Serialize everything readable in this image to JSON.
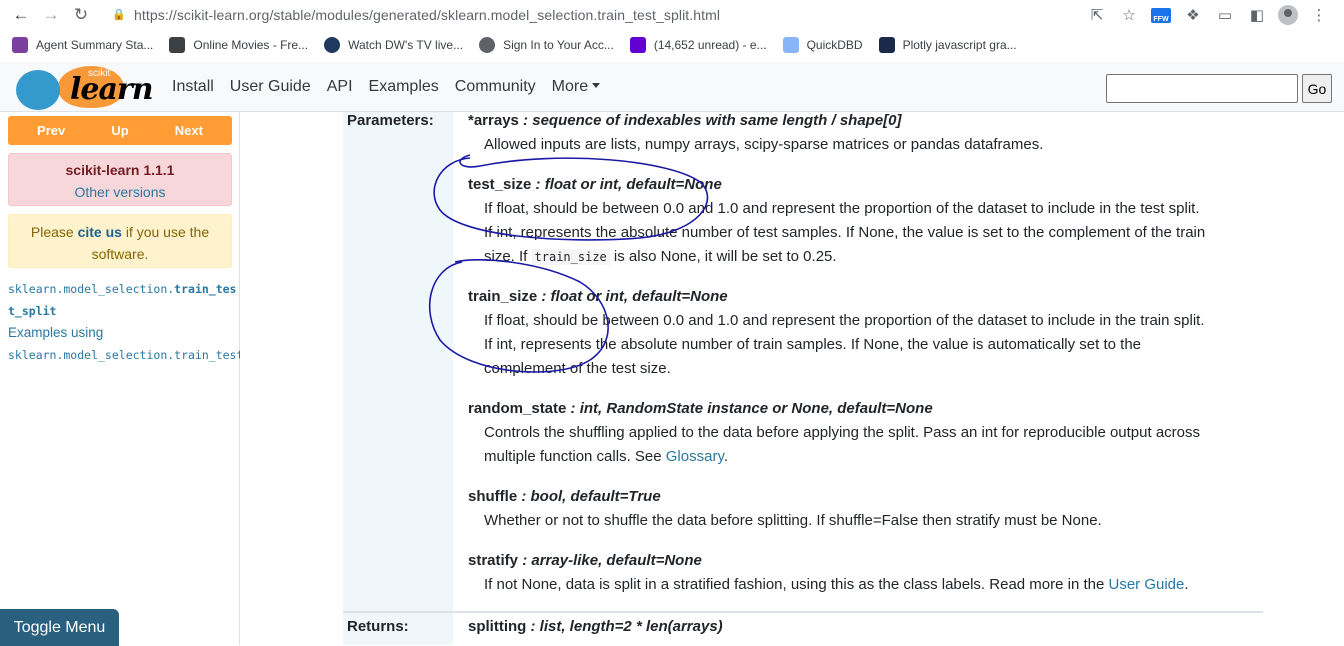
{
  "browser": {
    "url": "https://scikit-learn.org/stable/modules/generated/sklearn.model_selection.train_test_split.html",
    "bookmarks": [
      {
        "label": "Agent Summary Sta...",
        "color": "#7b3fa0"
      },
      {
        "label": "Online Movies - Fre...",
        "color": "#3c4043"
      },
      {
        "label": "Watch DW's TV live...",
        "color": "#1f3a5f"
      },
      {
        "label": "Sign In to Your Acc...",
        "color": "#5f6368"
      },
      {
        "label": "(14,652 unread) - e...",
        "color": "#6001d2"
      },
      {
        "label": "QuickDBD",
        "color": "#8ab4f8"
      },
      {
        "label": "Plotly javascript gra...",
        "color": "#1c2a4a"
      }
    ],
    "ext_label": "FFW"
  },
  "navbar": {
    "logo_small": "scikit",
    "logo_big": "learn",
    "links": [
      "Install",
      "User Guide",
      "API",
      "Examples",
      "Community",
      "More"
    ],
    "search_placeholder": "",
    "go_label": "Go"
  },
  "sidebar": {
    "prev": "Prev",
    "up": "Up",
    "next": "Next",
    "version_title": "scikit-learn 1.1.1",
    "other_versions": "Other versions",
    "cite_pre": "Please ",
    "cite_link": "cite us",
    "cite_post": " if you use the software.",
    "toc_module": "sklearn.model_selection.",
    "toc_func1": "train_tes",
    "toc_func2": "t_split",
    "toc_examples": "Examples using",
    "toc_examples_code": "sklearn.model_selection.train_test_split",
    "toggle_menu": "Toggle Menu"
  },
  "content": {
    "parameters_label": "Parameters:",
    "returns_label": "Returns:",
    "params": [
      {
        "name": "*arrays",
        "type": "sequence of indexables with same length / shape[0]",
        "desc": [
          "Allowed inputs are lists, numpy arrays, scipy-sparse matrices or pandas dataframes."
        ]
      },
      {
        "name": "test_size",
        "type": "float or int, default=None",
        "desc": [
          "If float, should be between 0.0 and 1.0 and represent the proportion of the dataset to include in the test split.",
          "If int, represents the absolute number of test samples. If None, the value is set to the complement of the train"
        ],
        "desc3_pre": "size. If ",
        "desc3_code": "train_size",
        "desc3_post": " is also None, it will be set to 0.25."
      },
      {
        "name": "train_size",
        "type": "float or int, default=None",
        "desc": [
          "If float, should be between 0.0 and 1.0 and represent the proportion of the dataset to include in the train split.",
          "If int, represents the absolute number of train samples. If None, the value is automatically set to the",
          "complement of the test size."
        ]
      },
      {
        "name": "random_state",
        "type": "int, RandomState instance or None, default=None",
        "desc": [
          "Controls the shuffling applied to the data before applying the split. Pass an int for reproducible output across"
        ],
        "desc2_pre": "multiple function calls. See ",
        "desc2_link": "Glossary",
        "desc2_post": "."
      },
      {
        "name": "shuffle",
        "type": "bool, default=True",
        "desc": [
          "Whether or not to shuffle the data before splitting. If shuffle=False then stratify must be None."
        ]
      },
      {
        "name": "stratify",
        "type": "array-like, default=None",
        "desc_pre": "If not None, data is split in a stratified fashion, using this as the class labels. Read more in the ",
        "desc_link": "User Guide",
        "desc_post": "."
      }
    ],
    "returns": {
      "name": "splitting",
      "type": "list, length=2 * len(arrays)"
    }
  },
  "colors": {
    "accent_orange": "#ff9c34",
    "link_blue": "#2878a2",
    "annotation_ink": "#1a1aa6"
  }
}
